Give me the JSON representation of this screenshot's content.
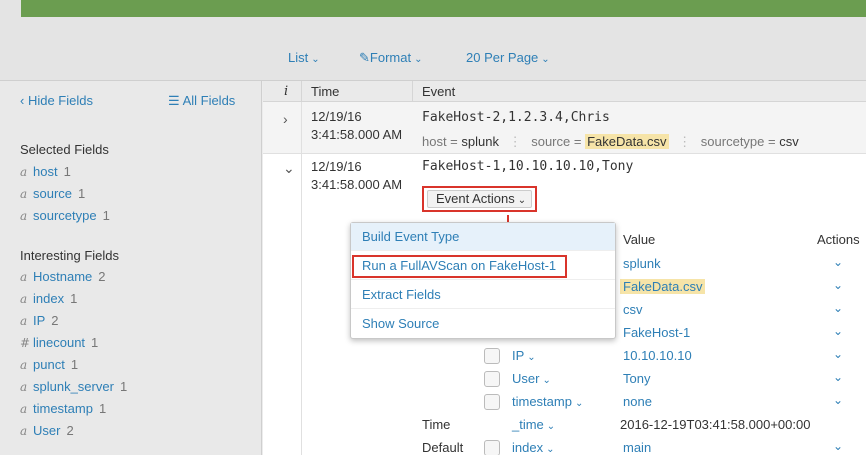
{
  "toolbar": {
    "list_label": "List",
    "format_label": "Format",
    "per_page_label": "20 Per Page"
  },
  "sidebar": {
    "hide_fields": "Hide Fields",
    "all_fields": "All Fields",
    "selected_heading": "Selected Fields",
    "selected": [
      {
        "type": "a",
        "name": "host",
        "count": "1"
      },
      {
        "type": "a",
        "name": "source",
        "count": "1"
      },
      {
        "type": "a",
        "name": "sourcetype",
        "count": "1"
      }
    ],
    "interesting_heading": "Interesting Fields",
    "interesting": [
      {
        "type": "a",
        "name": "Hostname",
        "count": "2"
      },
      {
        "type": "a",
        "name": "index",
        "count": "1"
      },
      {
        "type": "a",
        "name": "IP",
        "count": "2"
      },
      {
        "type": "#",
        "name": "linecount",
        "count": "1"
      },
      {
        "type": "a",
        "name": "punct",
        "count": "1"
      },
      {
        "type": "a",
        "name": "splunk_server",
        "count": "1"
      },
      {
        "type": "a",
        "name": "timestamp",
        "count": "1"
      },
      {
        "type": "a",
        "name": "User",
        "count": "2"
      }
    ]
  },
  "table": {
    "col_i": "i",
    "col_time": "Time",
    "col_event": "Event"
  },
  "event1": {
    "date": "12/19/16",
    "time": "3:41:58.000 AM",
    "raw": "FakeHost-2,1.2.3.4,Chris",
    "host_key": "host = ",
    "host_val": "splunk",
    "source_key": "source = ",
    "source_val": "FakeData.csv",
    "sourcetype_key": "sourcetype = ",
    "sourcetype_val": "csv"
  },
  "event2": {
    "date": "12/19/16",
    "time": "3:41:58.000 AM",
    "raw": "FakeHost-1,10.10.10.10,Tony",
    "event_actions": "Event Actions",
    "value_heading": "Value",
    "actions_heading": "Actions",
    "fields": [
      {
        "name": "",
        "value": "splunk"
      },
      {
        "name": "",
        "value": "FakeData.csv"
      },
      {
        "name": "",
        "value": "csv"
      },
      {
        "name": "",
        "value": "FakeHost-1"
      },
      {
        "name": "IP",
        "value": "10.10.10.10"
      },
      {
        "name": "User",
        "value": "Tony"
      },
      {
        "name": "timestamp",
        "value": "none"
      }
    ],
    "time_group": "Time",
    "time_field": "_time",
    "time_value": "2016-12-19T03:41:58.000+00:00",
    "default_group": "Default",
    "index_field": "index",
    "index_value": "main"
  },
  "dropdown": {
    "items": [
      "Build Event Type",
      "Run a FullAVScan on FakeHost-1",
      "Extract Fields",
      "Show Source"
    ]
  },
  "colors": {
    "accent": "#2e7fb6",
    "highlight_red": "#d9342b",
    "green_bar": "#6b9d50",
    "field_highlight": "#f6e4a8"
  }
}
